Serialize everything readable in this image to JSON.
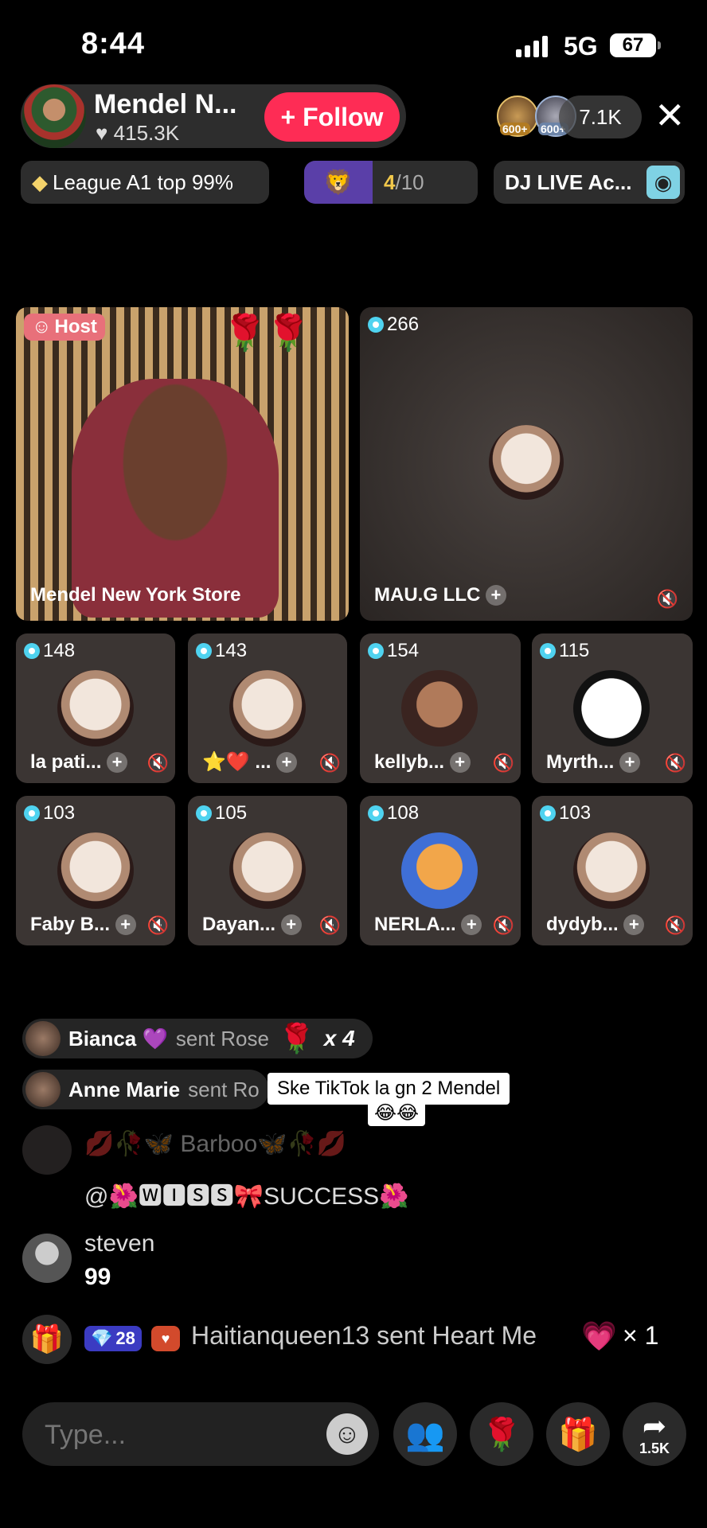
{
  "status_bar": {
    "time": "8:44",
    "network": "5G",
    "battery": "67"
  },
  "host": {
    "name": "Mendel N...",
    "likes": "415.3K",
    "follow_label": "+ Follow"
  },
  "viewers": {
    "count": "7.1K",
    "badge1": "600+",
    "badge2": "600+"
  },
  "chips": {
    "league": "League A1 top 99%",
    "progress_num": "4",
    "progress_den": "/10",
    "dj": "DJ LIVE Ac..."
  },
  "tiles": {
    "host": {
      "badge": "Host",
      "name": "Mendel New York Store"
    },
    "guest": {
      "count": "266",
      "name": "MAU.G LLC"
    },
    "row1": [
      {
        "count": "148",
        "name": "la pati..."
      },
      {
        "count": "143",
        "name": "⭐❤️ ..."
      },
      {
        "count": "154",
        "name": "kellyb..."
      },
      {
        "count": "115",
        "name": "Myrth..."
      }
    ],
    "row2": [
      {
        "count": "103",
        "name": "Faby B..."
      },
      {
        "count": "105",
        "name": "Dayan..."
      },
      {
        "count": "108",
        "name": "NERLA..."
      },
      {
        "count": "103",
        "name": "dydyb..."
      }
    ]
  },
  "gifts": [
    {
      "user": "Bianca 💜",
      "action": "sent Rose",
      "count": "x 4"
    },
    {
      "user": "Anne Marie",
      "action": "sent Ro"
    }
  ],
  "caption": {
    "line1": "Ske TikTok la gn 2 Mendel",
    "line2": "😂😂"
  },
  "chat": [
    {
      "user": "💋🥀🦋 Barboo🦋🥀💋",
      "text": "@🌺🆆🅸🆂🆂🎀SUCCESS🌺"
    },
    {
      "user": "steven",
      "text": "99"
    }
  ],
  "gift_banner": {
    "level": "28",
    "text": "Haitianqueen13 sent Heart Me",
    "count": "× 1"
  },
  "input": {
    "placeholder": "Type..."
  },
  "share_count": "1.5K"
}
